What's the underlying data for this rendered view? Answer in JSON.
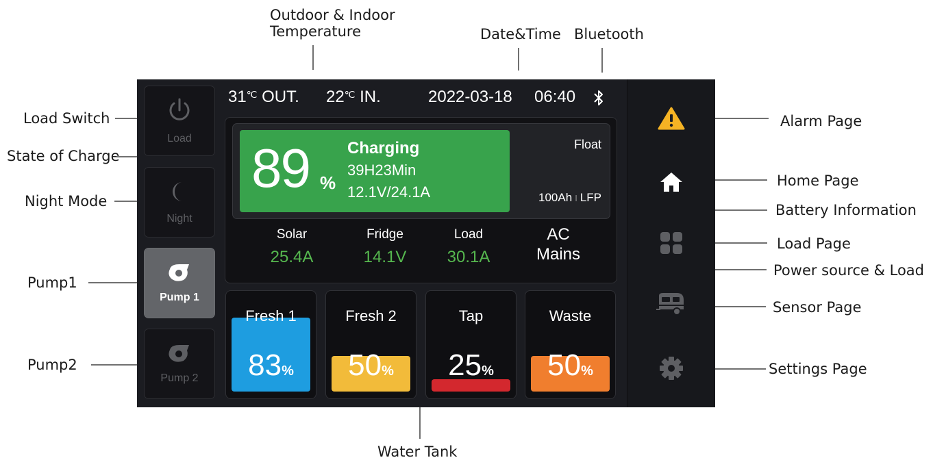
{
  "annotations": {
    "temperature": "Outdoor & Indoor\nTemperature",
    "datetime": "Date&Time",
    "bluetooth": "Bluetooth",
    "load_switch": "Load Switch",
    "state_of_charge": "State of Charge",
    "night_mode": "Night Mode",
    "pump1": "Pump1",
    "pump2": "Pump2",
    "water_tank": "Water Tank",
    "alarm_page": "Alarm Page",
    "home_page": "Home Page",
    "battery_information": "Battery Information",
    "load_page": "Load Page",
    "power_source_load": "Power source & Load",
    "sensor_page": "Sensor Page",
    "settings_page": "Settings Page"
  },
  "left_buttons": {
    "load": "Load",
    "night": "Night",
    "pump1": "Pump 1",
    "pump2": "Pump 2"
  },
  "status_bar": {
    "out_temp": "31",
    "out_unit": "℃",
    "out_label": "OUT.",
    "in_temp": "22",
    "in_unit": "℃",
    "in_label": "IN.",
    "date": "2022-03-18",
    "time": "06:40"
  },
  "battery": {
    "soc": "89",
    "soc_unit": "%",
    "state": "Charging",
    "time_remaining": "39H23Min",
    "voltage_current": "12.1V/24.1A",
    "mode": "Float",
    "capacity": "100Ah",
    "chemistry": "LFP",
    "separator": "I"
  },
  "power": {
    "solar_label": "Solar",
    "solar_value": "25.4A",
    "fridge_label": "Fridge",
    "fridge_value": "14.1V",
    "load_label": "Load",
    "load_value": "30.1A",
    "source_line1": "AC",
    "source_line2": "Mains"
  },
  "tanks": [
    {
      "name": "Fresh 1",
      "value": "83",
      "unit": "%",
      "level": 0.83,
      "color": "#1e9de0"
    },
    {
      "name": "Fresh 2",
      "value": "50",
      "unit": "%",
      "level": 0.5,
      "color": "#f2bb3a"
    },
    {
      "name": "Tap",
      "value": "25",
      "unit": "%",
      "level": 0.25,
      "color": "#d3282e"
    },
    {
      "name": "Waste",
      "value": "50",
      "unit": "%",
      "level": 0.5,
      "color": "#f07e2e"
    }
  ],
  "icons": {
    "bluetooth": "bluetooth-icon",
    "power": "power-icon",
    "night": "moon-icon",
    "pump": "pump-icon",
    "alarm": "warning-icon",
    "home": "home-icon",
    "load": "grid-icon",
    "sensor": "caravan-icon",
    "settings": "gear-icon"
  },
  "colors": {
    "accent_green": "#56b84f",
    "soc_green": "#38a34c",
    "alarm_yellow": "#f5b324"
  }
}
